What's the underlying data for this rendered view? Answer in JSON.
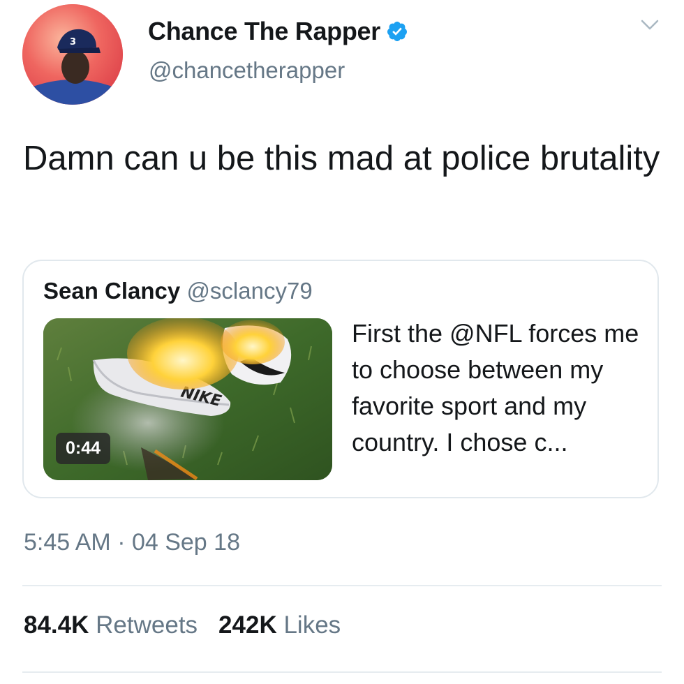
{
  "author": {
    "display_name": "Chance The Rapper",
    "handle": "@chancetherapper",
    "verified": true,
    "avatar_icon": "profile-photo",
    "avatar_cap_number": "3"
  },
  "tweet": {
    "text": "Damn can u be this mad at police brutality"
  },
  "quoted_tweet": {
    "display_name": "Sean Clancy",
    "handle": "@sclancy79",
    "text": "First the @NFL forces me to choose between my favorite sport and my country. I chose c...",
    "media": {
      "type": "video",
      "duration": "0:44",
      "shoe_brand_text": "NIKE"
    }
  },
  "meta": {
    "timestamp": "5:45 AM · 04 Sep 18"
  },
  "stats": {
    "retweets_count": "84.4K",
    "retweets_label": "Retweets",
    "likes_count": "242K",
    "likes_label": "Likes"
  },
  "colors": {
    "text_primary": "#14171a",
    "text_secondary": "#657786",
    "verified_blue": "#1da1f2",
    "border": "#e1e8ed"
  }
}
